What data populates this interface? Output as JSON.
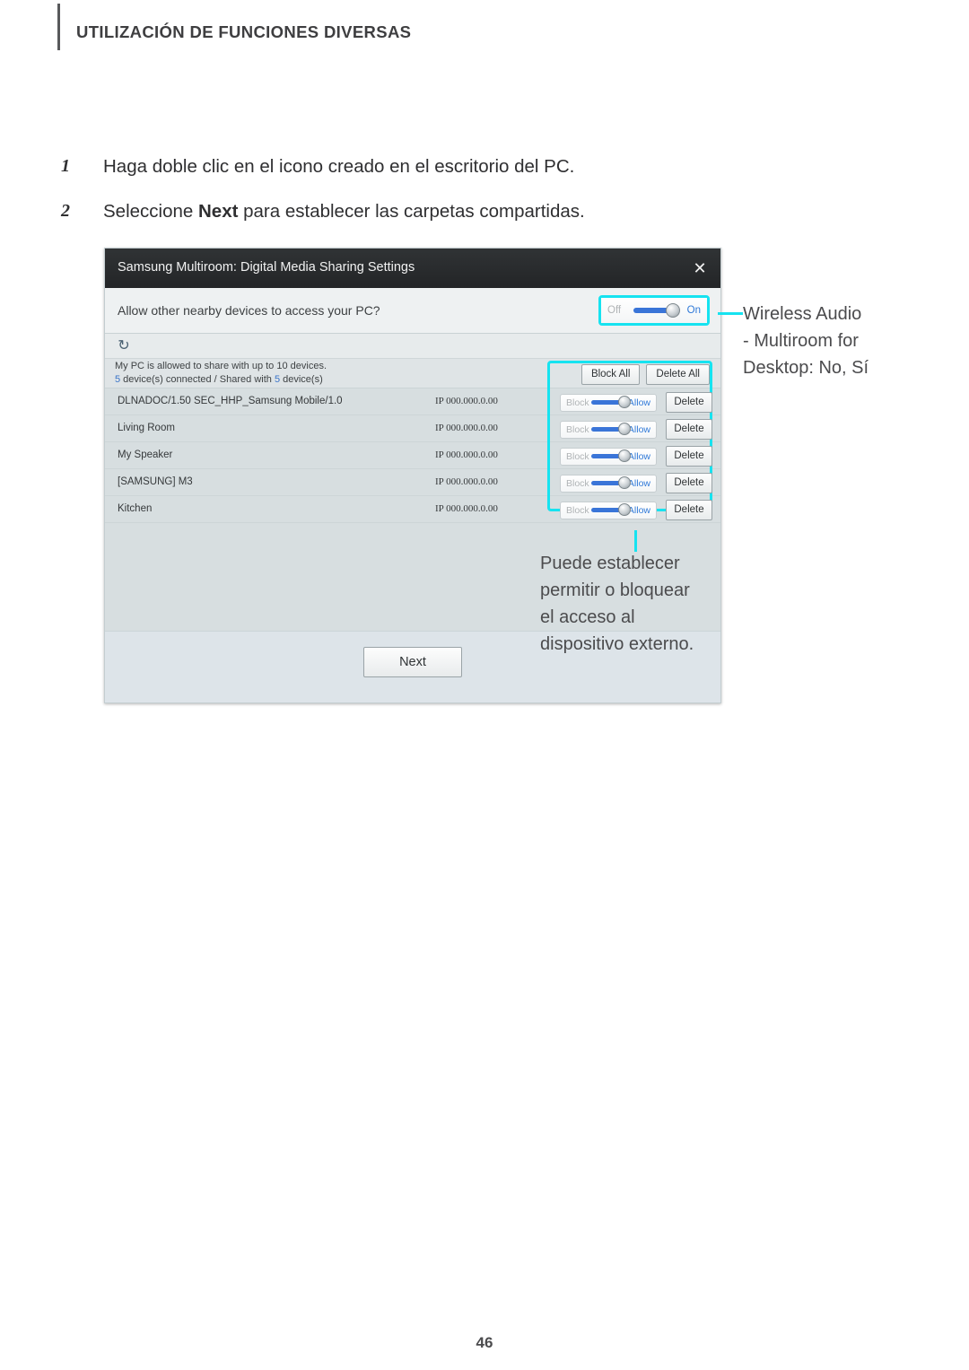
{
  "page": {
    "header_title": "UTILIZACIÓN DE FUNCIONES DIVERSAS",
    "page_number": "46",
    "accent_cyan": "#16e3f0",
    "titlebar_color": "#2b2d2f",
    "body_color": "#d7dee0"
  },
  "steps": [
    {
      "number": "1",
      "text": "Haga doble clic en el icono creado en el escritorio del PC."
    },
    {
      "number": "2",
      "text_before": "Seleccione ",
      "bold": "Next",
      "text_after": " para establecer las carpetas compartidas."
    }
  ],
  "dialog": {
    "title": "Samsung Multiroom: Digital Media Sharing Settings",
    "close_icon": "close-icon",
    "close_glyph": "✕",
    "access_question": "Allow other nearby devices to access your PC?",
    "master_toggle": {
      "off_label": "Off",
      "on_label": "On",
      "state": "On"
    },
    "refresh_icon": "refresh-icon",
    "refresh_glyph": "↻",
    "summary": {
      "line1": "My PC is allowed to share with up to 10 devices.",
      "connected_count": "5",
      "mid_text": " device(s) connected / Shared with ",
      "shared_count": "5",
      "end_text": " device(s)"
    },
    "bulk_actions": {
      "block_all": "Block All",
      "delete_all": "Delete All"
    },
    "row_toggle": {
      "block_label": "Block",
      "allow_label": "Allow",
      "state": "Allow"
    },
    "delete_label": "Delete",
    "devices": [
      {
        "name": "DLNADOC/1.50 SEC_HHP_Samsung Mobile/1.0",
        "ip": "IP 000.000.0.00"
      },
      {
        "name": "Living Room",
        "ip": "IP 000.000.0.00"
      },
      {
        "name": "My Speaker",
        "ip": "IP 000.000.0.00"
      },
      {
        "name": "[SAMSUNG] M3",
        "ip": "IP 000.000.0.00"
      },
      {
        "name": "Kitchen",
        "ip": "IP 000.000.0.00"
      }
    ],
    "next_label": "Next"
  },
  "callouts": {
    "top": "Wireless Audio\n- Multiroom for\nDesktop: No, Sí",
    "bottom": "Puede establecer\npermitir o bloquear\nel acceso al\ndispositivo externo."
  }
}
